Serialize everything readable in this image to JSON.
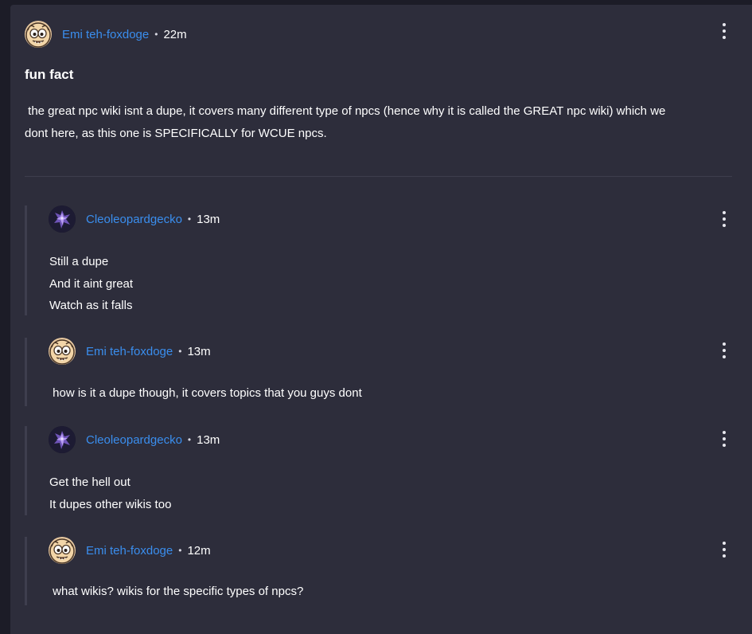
{
  "post": {
    "author": "Emi teh-foxdoge",
    "separator": "•",
    "time": "22m",
    "title": "fun fact",
    "body_lines": [
      " the great npc wiki isnt a dupe, it covers many different type of npcs (hence why it is called the GREAT npc wiki) which we",
      "dont here, as this one is SPECIFICALLY for WCUE npcs."
    ]
  },
  "replies": [
    {
      "author": "Cleoleopardgecko",
      "time": "13m",
      "avatar": "purple-creature-avatar",
      "lines": [
        "Still a dupe",
        "And it aint great",
        "Watch as it falls"
      ]
    },
    {
      "author": "Emi teh-foxdoge",
      "time": "13m",
      "avatar": "cartoon-face-avatar",
      "lines": [
        " how is it a dupe though, it covers topics that you guys dont"
      ]
    },
    {
      "author": "Cleoleopardgecko",
      "time": "13m",
      "avatar": "purple-creature-avatar",
      "lines": [
        "Get the hell out",
        "It dupes other wikis too"
      ]
    },
    {
      "author": "Emi teh-foxdoge",
      "time": "12m",
      "avatar": "cartoon-face-avatar",
      "lines": [
        " what wikis? wikis for the specific types of npcs?"
      ]
    }
  ],
  "icons": {
    "more": "more-options-icon"
  },
  "colors": {
    "background": "#2d2d3b",
    "link": "#3a8eee",
    "text": "#ffffff",
    "thread_line": "#3e3e4e"
  }
}
